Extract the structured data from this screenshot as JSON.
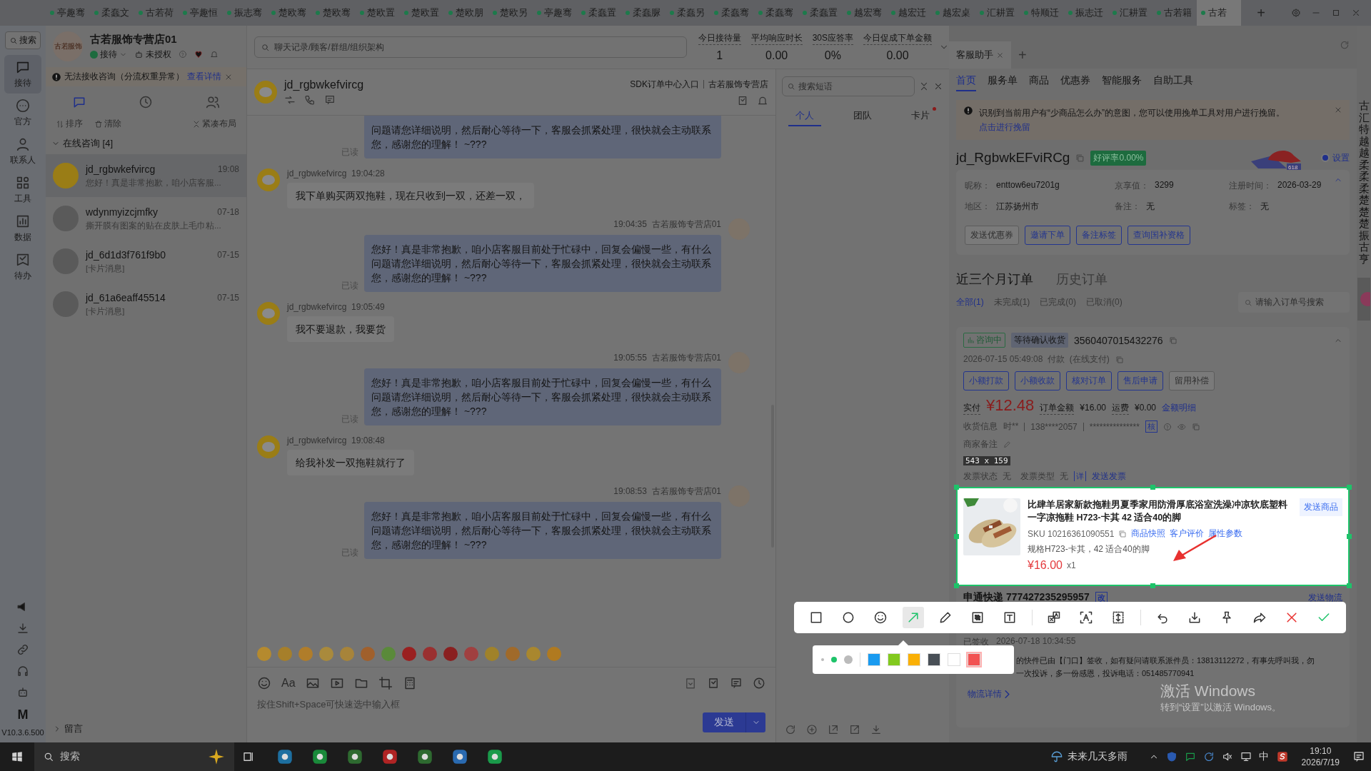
{
  "top_tabs": [
    {
      "label": "亭趣骞",
      "selected": false
    },
    {
      "label": "柔蠢文",
      "selected": false
    },
    {
      "label": "古若荷",
      "selected": false
    },
    {
      "label": "亭趣恒",
      "selected": false
    },
    {
      "label": "振志骞",
      "selected": false
    },
    {
      "label": "楚欧骞",
      "selected": false
    },
    {
      "label": "楚欧骞",
      "selected": false
    },
    {
      "label": "楚欧置",
      "selected": false
    },
    {
      "label": "楚欧置",
      "selected": false
    },
    {
      "label": "楚欧朋",
      "selected": false
    },
    {
      "label": "楚欧另",
      "selected": false
    },
    {
      "label": "亭趣骞",
      "selected": false
    },
    {
      "label": "柔蠢置",
      "selected": false
    },
    {
      "label": "柔蠢脲",
      "selected": false
    },
    {
      "label": "柔蠢另",
      "selected": false
    },
    {
      "label": "柔蠢骞",
      "selected": false
    },
    {
      "label": "柔蠢骞",
      "selected": false
    },
    {
      "label": "柔蠢置",
      "selected": false
    },
    {
      "label": "越宏骞",
      "selected": false
    },
    {
      "label": "越宏迁",
      "selected": false
    },
    {
      "label": "越宏桌",
      "selected": false
    },
    {
      "label": "汇耕置",
      "selected": false
    },
    {
      "label": "特顺迁",
      "selected": false
    },
    {
      "label": "振志迁",
      "selected": false
    },
    {
      "label": "汇耕置",
      "selected": false
    },
    {
      "label": "古若籍",
      "selected": false
    },
    {
      "label": "古若",
      "selected": true
    }
  ],
  "new_tab": "+",
  "rail": {
    "search": "搜索",
    "items": [
      {
        "label": "接待",
        "selected": true
      },
      {
        "label": "官方",
        "selected": false
      },
      {
        "label": "联系人",
        "selected": false
      },
      {
        "label": "工具",
        "selected": false
      },
      {
        "label": "数据",
        "selected": false
      },
      {
        "label": "待办",
        "selected": false
      }
    ],
    "logo": "M",
    "version": "V10.3.6.500"
  },
  "sessions": {
    "store": "古若服饰专营店01",
    "avatar_text": "古若服饰",
    "status": "接待",
    "auth": "未授权",
    "alert": "无法接收咨询（分流权重异常）",
    "alert_link": "查看详情",
    "icon_tabs": [
      {
        "selected": true
      },
      {
        "selected": false
      },
      {
        "selected": false
      }
    ],
    "actions": [
      "排序",
      "清除",
      "紧凑布局"
    ],
    "group": {
      "label": "在线咨询 [4]",
      "expanded": true
    },
    "items": [
      {
        "name": "jd_rgbwkefvircg",
        "time": "19:08",
        "preview": "您好！真是非常抱歉，咱小店客服...",
        "selected": true
      },
      {
        "name": "wdynmyizcjmfky",
        "time": "07-18",
        "preview": "撕开膜有图案的贴在皮肤上毛巾粘...",
        "selected": false
      },
      {
        "name": "jd_6d1d3f761f9b0",
        "time": "07-15",
        "preview": "[卡片消息]",
        "selected": false
      },
      {
        "name": "jd_61a6eaff45514",
        "time": "07-15",
        "preview": "[卡片消息]",
        "selected": false
      }
    ],
    "footer": "留言"
  },
  "chat": {
    "search_placeholder": "聊天记录/顾客/群组/组织架构",
    "stats": [
      {
        "label": "今日接待量",
        "value": "1"
      },
      {
        "label": "平均响应时长",
        "value": "0.00"
      },
      {
        "label": "30S应答率",
        "value": "0%"
      },
      {
        "label": "今日促成下单金额",
        "value": "0.00"
      }
    ],
    "customer": "jd_rgbwkefvircg",
    "sdk_link": "SDK订单中心入口",
    "store": "古若服饰专营店",
    "messages": [
      {
        "kind": "agent",
        "text": "问题请您详细说明，然后耐心等待一下，客服会抓紧处理，很快就会主动联系您，感谢您的理解！ ~???",
        "read": "已读"
      },
      {
        "kind": "customer",
        "sender": "jd_rgbwkefvircg",
        "time": "19:04:28",
        "text": "我下单购买两双拖鞋，现在只收到一双，还差一双，"
      },
      {
        "kind": "agent",
        "sender": "古若服饰专营店01",
        "time": "19:04:35",
        "text": "您好！真是非常抱歉，咱小店客服目前处于忙碌中，回复会偏慢一些，有什么问题请您详细说明，然后耐心等待一下，客服会抓紧处理，很快就会主动联系您，感谢您的理解！ ~???",
        "read": "已读"
      },
      {
        "kind": "customer",
        "sender": "jd_rgbwkefvircg",
        "time": "19:05:49",
        "text": "我不要退款，我要货"
      },
      {
        "kind": "agent",
        "sender": "古若服饰专营店01",
        "time": "19:05:55",
        "text": "您好！真是非常抱歉，咱小店客服目前处于忙碌中，回复会偏慢一些，有什么问题请您详细说明，然后耐心等待一下，客服会抓紧处理，很快就会主动联系您，感谢您的理解！ ~???",
        "read": "已读"
      },
      {
        "kind": "customer",
        "sender": "jd_rgbwkefvircg",
        "time": "19:08:48",
        "text": "给我补发一双拖鞋就行了"
      },
      {
        "kind": "agent",
        "sender": "古若服饰专营店01",
        "time": "19:08:53",
        "text": "您好！真是非常抱歉，咱小店客服目前处于忙碌中，回复会偏慢一些，有什么问题请您详细说明，然后耐心等待一下，客服会抓紧处理，很快就会主动联系您，感谢您的理解！ ~???",
        "read": "已读"
      }
    ],
    "font_button": "Aa",
    "input_placeholder": "按住Shift+Space可快速选中输入框",
    "send": "发送"
  },
  "phrases": {
    "search_placeholder": "搜索短语",
    "tabs": [
      {
        "label": "个人",
        "selected": true,
        "dot": false
      },
      {
        "label": "团队",
        "selected": false,
        "dot": false
      },
      {
        "label": "卡片",
        "selected": false,
        "dot": true
      }
    ]
  },
  "assistant": {
    "tab": "客服助手",
    "new_tab": "+",
    "nav": [
      {
        "label": "首页",
        "selected": true
      },
      {
        "label": "服务单",
        "selected": false
      },
      {
        "label": "商品",
        "selected": false
      },
      {
        "label": "优惠券",
        "selected": false
      },
      {
        "label": "智能服务",
        "selected": false
      },
      {
        "label": "自助工具",
        "selected": false
      }
    ],
    "notice": "识别到当前用户有“少商品怎么办”的意图，您可以使用挽单工具对用户进行挽留。",
    "notice_link": "点击进行挽留",
    "user": "jd_RgbwkEFviRCg",
    "rating": "好评率0.00%",
    "banner_text": "618",
    "settings": "设置",
    "fields": [
      {
        "label": "昵称：",
        "value": "enttow6eu7201g"
      },
      {
        "label": "京享值：",
        "value": "3299"
      },
      {
        "label": "注册时间：",
        "value": "2026-03-29"
      },
      {
        "label": "地区：",
        "value": "江苏扬州市"
      },
      {
        "label": "备注：",
        "value": "无"
      },
      {
        "label": "标签：",
        "value": "无"
      }
    ],
    "buttons": [
      {
        "label": "发送优惠券",
        "disabled": true
      },
      {
        "label": "邀请下单",
        "disabled": false
      },
      {
        "label": "备注标签",
        "disabled": false
      },
      {
        "label": "查询国补资格",
        "disabled": false
      }
    ],
    "order_tabs": [
      {
        "label": "近三个月订单",
        "selected": true
      },
      {
        "label": "历史订单",
        "selected": false
      }
    ],
    "filters": [
      {
        "label": "全部(1)",
        "selected": true
      },
      {
        "label": "未完成(1)",
        "selected": false
      },
      {
        "label": "已完成(0)",
        "selected": false
      },
      {
        "label": "已取消(0)",
        "selected": false
      }
    ],
    "order_search_placeholder": "请输入订单号搜索",
    "order": {
      "tag": "咨询中",
      "status": "等待确认收货",
      "id": "3560407015432276",
      "paid_time": "2026-07-15 05:49:08  付款  (在线支付)",
      "buttons": [
        {
          "label": "小额打款",
          "disabled": false
        },
        {
          "label": "小额收款",
          "disabled": false
        },
        {
          "label": "核对订单",
          "disabled": false
        },
        {
          "label": "售后申请",
          "disabled": false
        },
        {
          "label": "留用补偿",
          "disabled": true
        }
      ],
      "paid_label": "实付",
      "paid": "¥12.48",
      "amount_label": "订单金额",
      "amount": "¥16.00",
      "freight_label": "运费",
      "freight": "¥0.00",
      "detail_link": "金额明细",
      "address_label": "收货信息",
      "receiver": "时**",
      "phone": "138****2057",
      "address": "***************",
      "verify": "核",
      "merchant_note": "商家备注",
      "invoice": "发票状态  无    发票类型  无",
      "invoice_detail": "详",
      "invoice_send": "发送发票",
      "product": {
        "title": "比肆羊居家新款拖鞋男夏季家用防滑厚底浴室洗澡冲凉软底塑料一字凉拖鞋 H723-卡其 42 适合40的脚",
        "sku": "SKU 10216361090551",
        "links": [
          "商品快照",
          "客户评价",
          "属性参数"
        ],
        "spec": "规格H723-卡其，42 适合40的脚",
        "price": "¥16.00",
        "qty": "x1",
        "send": "发送商品"
      },
      "carrier": "申通快递 777427235295957",
      "change": "改",
      "send_logistics": "发送物流",
      "delivery_status": "已签收",
      "delivery_time": "2026-07-18 10:34:55",
      "logistics": [
        "的快件已由【门口】签收，如有疑问请联系派件员：13813112272，有事先呼叫我，勿",
        "一次投诉，多一份感恩，投诉电话：051485770941"
      ],
      "logistics_link": "物流详情"
    }
  },
  "capture": {
    "size": "543 x 159",
    "tools": [
      {
        "kind": "rect",
        "selected": false
      },
      {
        "kind": "ellipse",
        "selected": false
      },
      {
        "kind": "emoji",
        "selected": false
      },
      {
        "kind": "arrow",
        "selected": true
      },
      {
        "kind": "pen",
        "selected": false
      },
      {
        "kind": "mosaic",
        "selected": false
      },
      {
        "kind": "text",
        "selected": false
      },
      {
        "kind": "sep"
      },
      {
        "kind": "translate",
        "selected": false
      },
      {
        "kind": "ocr",
        "selected": false
      },
      {
        "kind": "scroll",
        "selected": false
      },
      {
        "kind": "sep"
      },
      {
        "kind": "undo",
        "selected": false
      },
      {
        "kind": "save",
        "selected": false
      },
      {
        "kind": "pin",
        "selected": false
      },
      {
        "kind": "share",
        "selected": false
      },
      {
        "kind": "cancel"
      },
      {
        "kind": "done"
      }
    ],
    "sizes": [
      {
        "selected": false
      },
      {
        "selected": true
      },
      {
        "selected": false
      }
    ],
    "colors": [
      {
        "color": "#1a9bf0",
        "selected": false
      },
      {
        "color": "#82c91e",
        "selected": false
      },
      {
        "color": "#fab005",
        "selected": false
      },
      {
        "color": "#495057",
        "selected": false
      },
      {
        "color": "#ffffff",
        "selected": false
      },
      {
        "color": "#f25252",
        "selected": true
      }
    ]
  },
  "edge_strip": "古汇特越越柔柔柔楚楚楚振古亨",
  "os_notice": {
    "title": "激活 Windows",
    "text": "转到“设置”以激活 Windows。"
  },
  "taskbar": {
    "search": "搜索",
    "weather": "未来几天多雨",
    "ime": "中",
    "time": "19:10",
    "date": "2026/7/19"
  }
}
